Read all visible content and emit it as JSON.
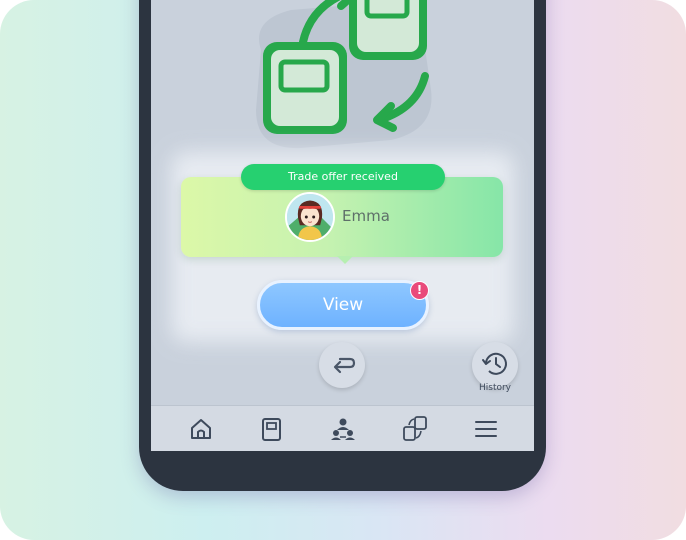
{
  "trade": {
    "banner": "Trade offer received",
    "trainer_name": "Emma",
    "view_label": "View",
    "alert_badge": "!"
  },
  "actions": {
    "history_label": "History"
  },
  "nav": {
    "items": [
      "home-icon",
      "dex-card-icon",
      "friends-icon",
      "trade-icon",
      "menu-icon"
    ],
    "active": "friends-icon"
  },
  "colors": {
    "trade_green": "#26d070",
    "view_blue": "#7cbcff",
    "alert_pink": "#e94a7a"
  }
}
